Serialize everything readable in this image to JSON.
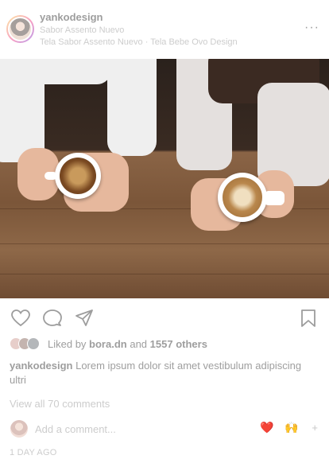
{
  "header": {
    "username": "yankodesign",
    "subtitle": "Sabor Assento Nuevo",
    "audio": "Tela Sabor Assento Nuevo · Tela Bebe Ovo Design",
    "more_label": "···"
  },
  "photo": {
    "alt": "Two people holding coffee cups over a wooden table"
  },
  "actions": {
    "icons": [
      "heart-icon",
      "comment-icon",
      "share-icon",
      "bookmark-icon"
    ]
  },
  "likes": {
    "prefix": "Liked by",
    "user": "bora.dn",
    "joiner": "and",
    "count": "1557",
    "suffix": "others"
  },
  "caption": {
    "username": "yankodesign",
    "text": "Lorem ipsum dolor sit amet vestibulum adipiscing ultri"
  },
  "comments": {
    "view_all": "View all 70 comments",
    "placeholder": "Add a comment...",
    "emoji_1": "❤️",
    "emoji_2": "🙌",
    "more": "+"
  },
  "timestamp": "1 DAY AGO"
}
